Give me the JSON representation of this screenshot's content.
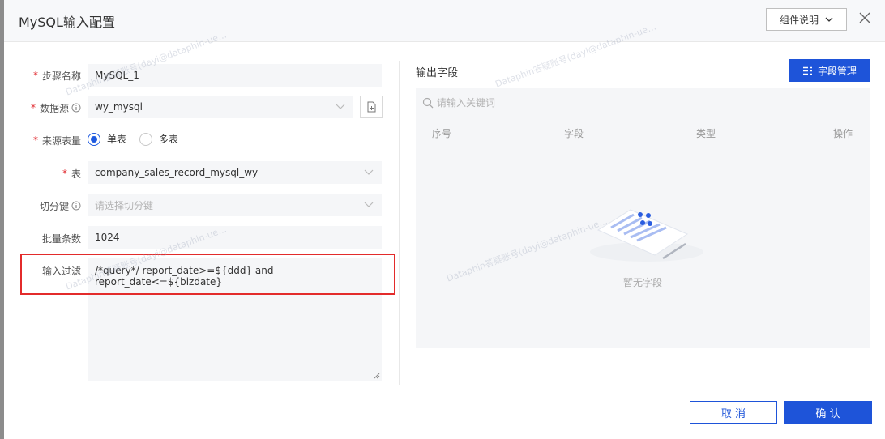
{
  "dialog": {
    "title": "MySQL输入配置",
    "help_button": "组件说明",
    "close_icon": "close-icon"
  },
  "form": {
    "step_name": {
      "label": "步骤名称",
      "required": true,
      "value": "MySQL_1"
    },
    "datasource": {
      "label": "数据源",
      "required": true,
      "value": "wy_mysql"
    },
    "source_table": {
      "label": "来源表量",
      "required": true,
      "options": [
        "单表",
        "多表"
      ],
      "selected": "单表"
    },
    "table": {
      "label": "表",
      "required": true,
      "value": "company_sales_record_mysql_wy"
    },
    "split_key": {
      "label": "切分键",
      "placeholder": "请选择切分键"
    },
    "batch": {
      "label": "批量条数",
      "value": "1024"
    },
    "filter": {
      "label": "输入过滤",
      "value": "/*query*/ report_date>=${ddd} and report_date<=${bizdate}"
    }
  },
  "output": {
    "title": "输出字段",
    "manage_button": "字段管理",
    "search_placeholder": "请输入关键词",
    "columns": [
      "序号",
      "字段",
      "类型",
      "操作"
    ],
    "empty_text": "暂无字段"
  },
  "footer": {
    "cancel": "取 消",
    "confirm": "确 认"
  },
  "watermark": "Dataphin答疑账号(dayi@dataphin-ue…",
  "colors": {
    "primary": "#1e54d9",
    "required": "#e0282e",
    "highlight": "#e32b2b"
  }
}
